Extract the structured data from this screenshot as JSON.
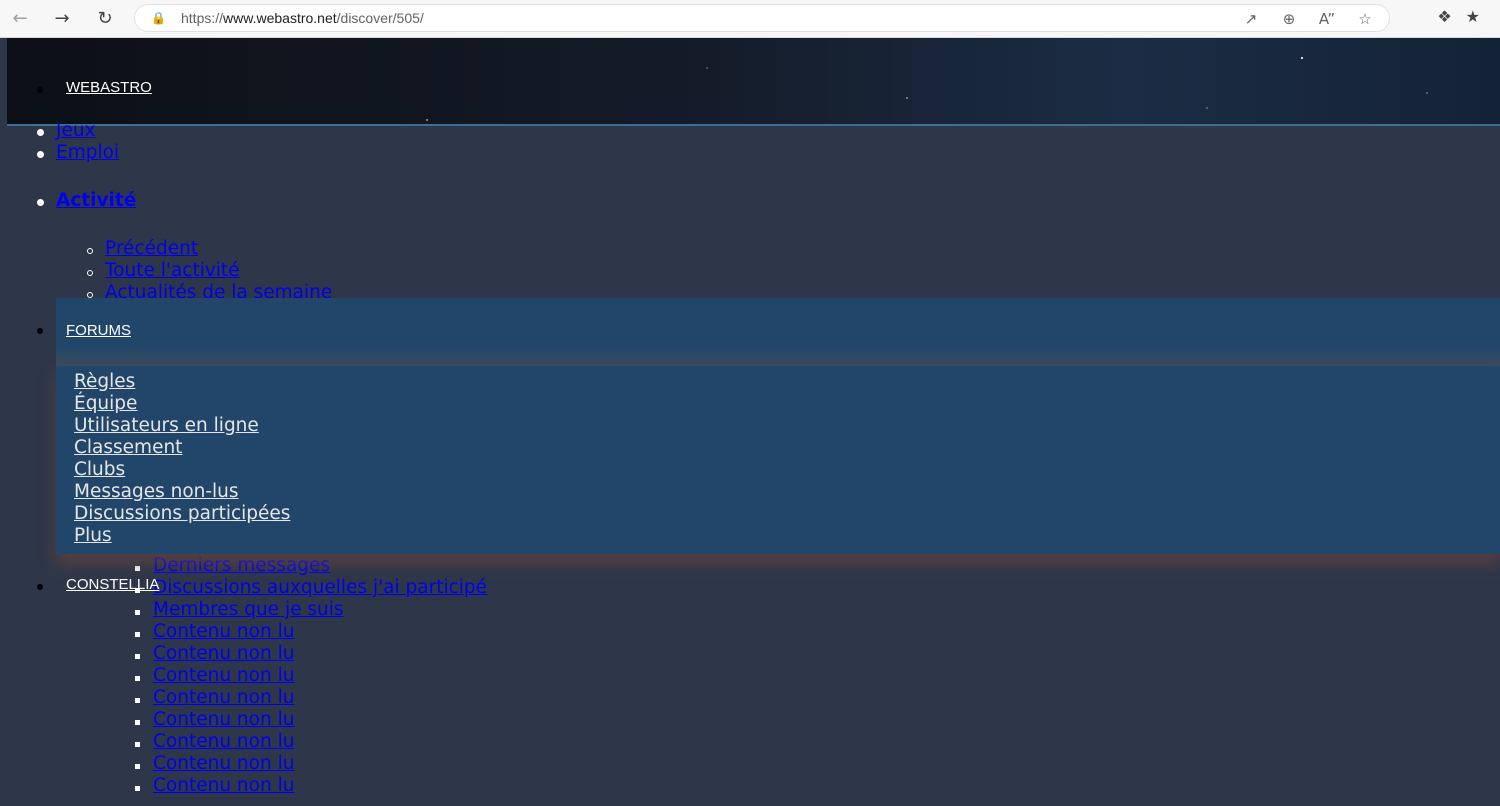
{
  "browser": {
    "url_prefix": "https://",
    "url_host": "www.webastro.net",
    "url_path": "/discover/505/"
  },
  "site": {
    "brand": "WEBASTRO",
    "nav": [
      {
        "label": "Jeux"
      },
      {
        "label": "Emploi"
      },
      {
        "label": "Activité"
      }
    ],
    "activity_sub": [
      {
        "label": "Précédent"
      },
      {
        "label": "Toute l'activité"
      },
      {
        "label": "Actualités de la semaine"
      }
    ],
    "forums": {
      "label": "FORUMS",
      "items": [
        {
          "label": "Règles"
        },
        {
          "label": "Équipe"
        },
        {
          "label": "Utilisateurs en ligne"
        },
        {
          "label": "Classement"
        },
        {
          "label": "Clubs"
        },
        {
          "label": "Messages non-lus"
        },
        {
          "label": "Discussions participées"
        },
        {
          "label": "Plus"
        }
      ]
    },
    "constellia": "CONSTELLIA",
    "deep_list": [
      {
        "label": "Derniers messages"
      },
      {
        "label": "Discussions auxquelles j'ai participé"
      },
      {
        "label": "Membres que je suis"
      },
      {
        "label": "Contenu non lu"
      },
      {
        "label": "Contenu non lu"
      },
      {
        "label": "Contenu non lu"
      },
      {
        "label": "Contenu non lu"
      },
      {
        "label": "Contenu non lu"
      },
      {
        "label": "Contenu non lu"
      },
      {
        "label": "Contenu non lu"
      },
      {
        "label": "Contenu non lu"
      }
    ]
  }
}
